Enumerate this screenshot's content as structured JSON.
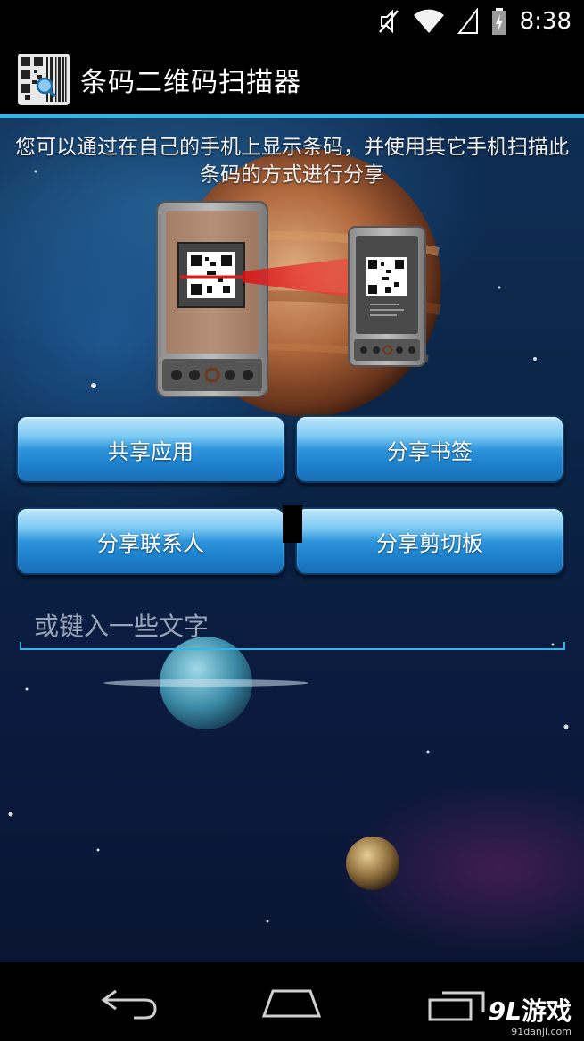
{
  "status_bar": {
    "time": "8:38",
    "icons": [
      "mute-icon",
      "wifi-icon",
      "signal-icon",
      "battery-icon"
    ]
  },
  "action_bar": {
    "title": "条码二维码扫描器",
    "icon": "barcode-app-icon"
  },
  "intro": {
    "text": "您可以通过在自己的手机上显示条码，并使用其它手机扫描此条码的方式进行分享"
  },
  "buttons": {
    "share_app": "共享应用",
    "share_bookmark": "分享书签",
    "share_contact": "分享联系人",
    "share_clipboard": "分享剪切板"
  },
  "input": {
    "placeholder": "或键入一些文字",
    "value": ""
  },
  "nav_bar": {
    "icons": [
      "back-icon",
      "home-icon",
      "recent-apps-icon"
    ]
  },
  "watermark": {
    "num": "9L",
    "text": "游戏",
    "url": "91danji.com"
  },
  "colors": {
    "accent": "#33b5e5",
    "button_blue": "#1d7fcb",
    "background": "#0a2244"
  }
}
